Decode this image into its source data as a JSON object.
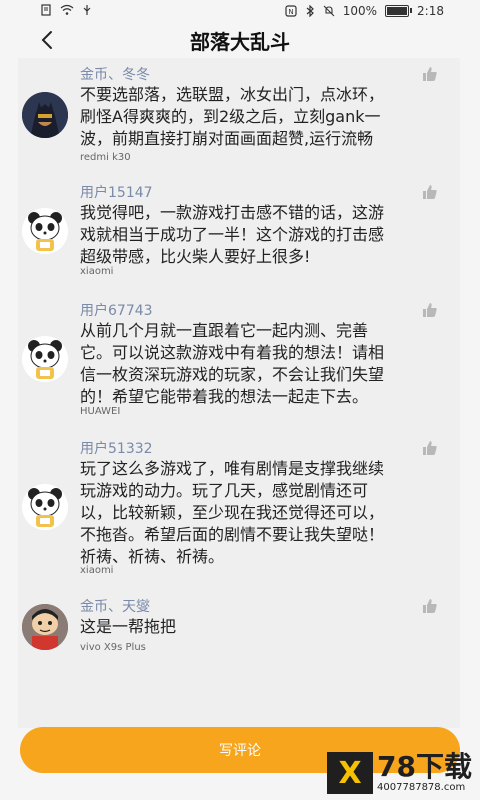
{
  "status_bar": {
    "battery": "100%",
    "time": "2:18",
    "battery_level": 1.0
  },
  "header": {
    "title": "部落大乱斗"
  },
  "comments": [
    {
      "user": "金币、冬冬",
      "text": "不要选部落，选联盟，冰女出门，点冰环，\n刷怪A得爽爽的，到2级之后，立刻gank一\n波，前期直接打崩对面画面超赞,运行流畅",
      "device": "redmi k30",
      "avatar": "dark-hero-avatar"
    },
    {
      "user": "用户15147",
      "text": "我觉得吧，一款游戏打击感不错的话，这游\n戏就相当于成功了一半！这个游戏的打击感\n超级带感，比火柴人要好上很多!",
      "device": "xiaomi",
      "avatar": "panda-avatar"
    },
    {
      "user": "用户67743",
      "text": "从前几个月就一直跟着它一起内测、完善\n它。可以说这款游戏中有着我的想法！请相\n信一枚资深玩游戏的玩家，不会让我们失望\n的！希望它能带着我的想法一起走下去。",
      "device": "HUAWEI",
      "avatar": "panda-avatar"
    },
    {
      "user": "用户51332",
      "text": "玩了这么多游戏了，唯有剧情是支撑我继续\n玩游戏的动力。玩了几天，感觉剧情还可\n以，比较新颖，至少现在我还觉得还可以，\n不拖沓。希望后面的剧情不要让我失望哒！\n祈祷、祈祷、祈祷。",
      "device": "xiaomi",
      "avatar": "panda-avatar"
    },
    {
      "user": "金币、天燮",
      "text": "这是一帮拖把",
      "device": "vivo X9s Plus",
      "avatar": "cartoon-boy-avatar"
    }
  ],
  "write_button": {
    "label": "写评论",
    "color": "#f6a51c"
  },
  "watermark": {
    "main": "78下载",
    "sub": "4007787878.com"
  }
}
